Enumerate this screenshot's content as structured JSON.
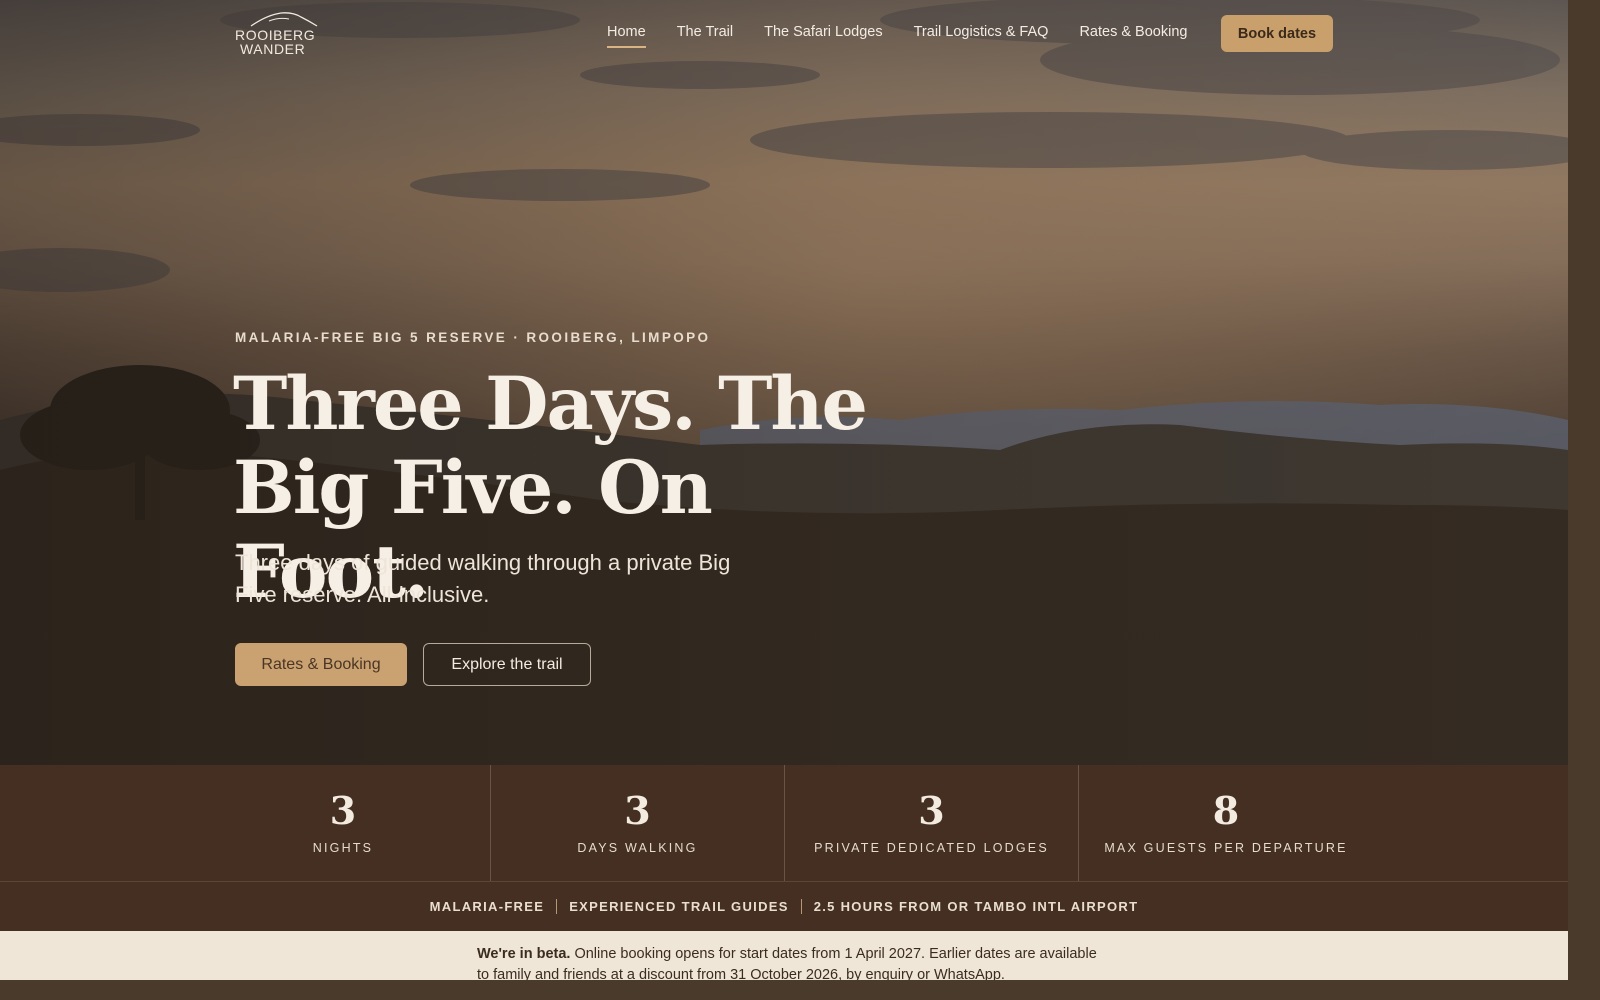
{
  "brand": {
    "line1": "ROOIBERG",
    "line2": "WANDER"
  },
  "nav": {
    "links": [
      {
        "label": "Home",
        "active": true
      },
      {
        "label": "The Trail"
      },
      {
        "label": "The Safari Lodges"
      },
      {
        "label": "Trail Logistics & FAQ"
      },
      {
        "label": "Rates & Booking"
      }
    ],
    "cta": "Book dates"
  },
  "hero": {
    "eyebrow": "MALARIA-FREE BIG 5 RESERVE · ROOIBERG, LIMPOPO",
    "headline": "Three Days. The Big Five. On Foot.",
    "subhead": "Three days of guided walking through a private Big Five reserve. All-inclusive.",
    "primary_cta": "Rates & Booking",
    "secondary_cta": "Explore the trail"
  },
  "stats": [
    {
      "value": "3",
      "label": "NIGHTS"
    },
    {
      "value": "3",
      "label": "DAYS WALKING"
    },
    {
      "value": "3",
      "label": "PRIVATE DEDICATED LODGES"
    },
    {
      "value": "8",
      "label": "MAX GUESTS PER DEPARTURE"
    }
  ],
  "features": [
    "MALARIA-FREE",
    "EXPERIENCED TRAIL GUIDES",
    "2.5 HOURS FROM OR TAMBO INTL AIRPORT"
  ],
  "beta": {
    "lead": "We're in beta.",
    "text": "Online booking opens for start dates from 1 April 2027. Earlier dates are available to family and friends at a discount from 31 October 2026, by enquiry or WhatsApp."
  },
  "colors": {
    "accent": "#c9a06b",
    "band": "#442f22",
    "notice_bg": "#efe6d8"
  }
}
